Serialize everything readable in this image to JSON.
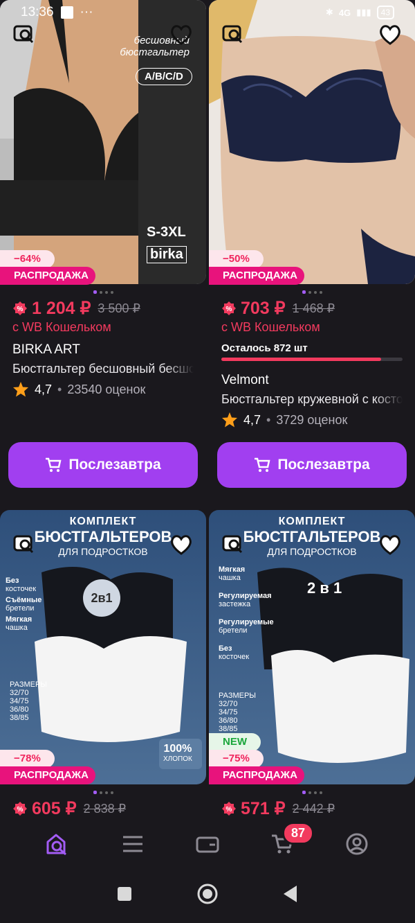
{
  "status": {
    "time": "13:36",
    "network": "4G",
    "battery": "43"
  },
  "products": [
    {
      "discount": "−64%",
      "sale": "РАСПРОДАЖА",
      "price": "1 204 ₽",
      "old_price": "3 500 ₽",
      "wallet": "с WB Кошельком",
      "brand": "BIRKA ART",
      "title": "Бюстгальтер бесшовный бесшовный",
      "rating": "4,7",
      "reviews": "23540 оценок",
      "button": "Послезавтра",
      "img_text": [
        "бесшовный",
        "бюстгальтер",
        "A/B/C/D",
        "S-3XL",
        "birka"
      ]
    },
    {
      "discount": "−50%",
      "sale": "РАСПРОДАЖА",
      "price": "703 ₽",
      "old_price": "1 468 ₽",
      "wallet": "с WB Кошельком",
      "stock": "Осталось 872 шт",
      "stock_fill": 0.88,
      "brand": "Velmont",
      "title": "Бюстгальтер кружевной с косточками",
      "rating": "4,7",
      "reviews": "3729 оценок",
      "button": "Послезавтра"
    },
    {
      "discount": "−78%",
      "sale": "РАСПРОДАЖА",
      "price": "605 ₽",
      "old_price": "2 838 ₽",
      "img_text": [
        "КОМПЛЕКТ",
        "БЮСТГАЛЬТЕРОВ",
        "ДЛЯ ПОДРОСТКОВ",
        "2в1",
        "Без",
        "косточек",
        "Съёмные",
        "бретели",
        "Мягкая",
        "чашка",
        "РАЗМЕРЫ",
        "32/70",
        "34/75",
        "36/80",
        "38/85",
        "100%",
        "ХЛОПОК"
      ]
    },
    {
      "discount": "−75%",
      "new": "NEW",
      "sale": "РАСПРОДАЖА",
      "price": "571 ₽",
      "old_price": "2 442 ₽",
      "img_text": [
        "КОМПЛЕКТ",
        "БЮСТГАЛЬТЕРОВ",
        "ДЛЯ ПОДРОСТКОВ",
        "2 в 1",
        "Мягкая",
        "чашка",
        "Регулируемая",
        "застежка",
        "Регулируемые",
        "бретели",
        "Без",
        "косточек",
        "РАЗМЕРЫ",
        "32/70",
        "34/75",
        "36/80",
        "38/85"
      ]
    }
  ],
  "nav": {
    "cart_count": "87"
  },
  "colors": {
    "accent": "#a13ff0",
    "price": "#f23a5e",
    "sale": "#e8137c"
  }
}
